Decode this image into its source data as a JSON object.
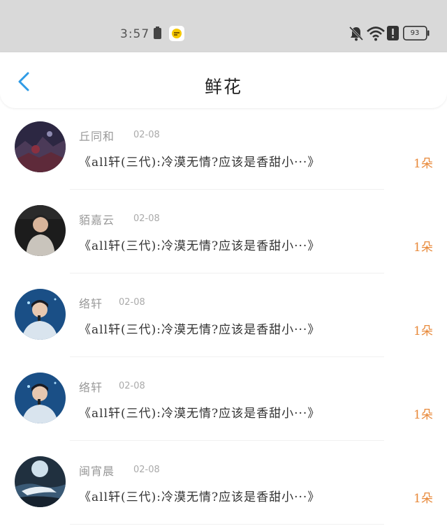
{
  "status_bar": {
    "time": "3:57",
    "battery_level": "93",
    "icons": [
      "battery-small-icon",
      "message-app-icon",
      "bell-muted-icon",
      "wifi-icon",
      "alert-icon",
      "battery-icon"
    ]
  },
  "header": {
    "title": "鲜花",
    "back_icon": "chevron-left-icon"
  },
  "colors": {
    "accent_blue": "#2f9be6",
    "count_orange": "#e8893a",
    "status_bg": "#d9d9d9"
  },
  "items": [
    {
      "name": "丘同和",
      "date": "02-08",
      "title": "《all轩(三代):冷漠无情?应该是香甜小···》",
      "count": "1朵"
    },
    {
      "name": "貊嘉云",
      "date": "02-08",
      "title": "《all轩(三代):冷漠无情?应该是香甜小···》",
      "count": "1朵"
    },
    {
      "name": "络轩",
      "date": "02-08",
      "title": "《all轩(三代):冷漠无情?应该是香甜小···》",
      "count": "1朵"
    },
    {
      "name": "络轩",
      "date": "02-08",
      "title": "《all轩(三代):冷漠无情?应该是香甜小···》",
      "count": "1朵"
    },
    {
      "name": "闽宵晨",
      "date": "02-08",
      "title": "《all轩(三代):冷漠无情?应该是香甜小···》",
      "count": "1朵"
    }
  ]
}
